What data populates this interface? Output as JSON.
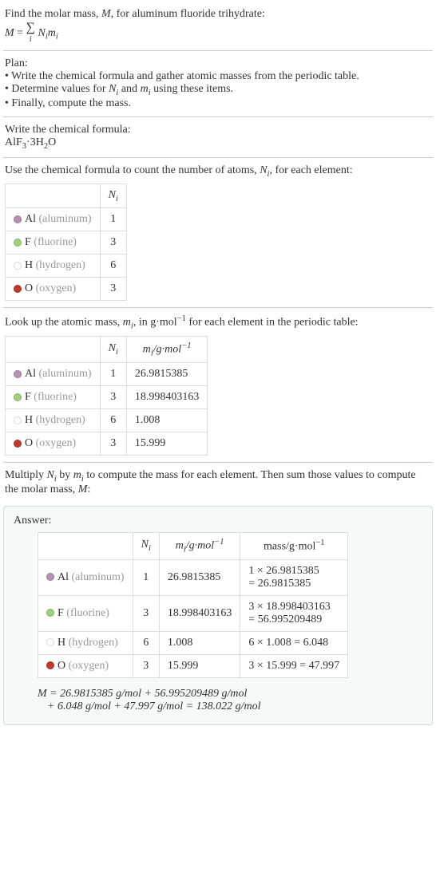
{
  "intro": {
    "line1_a": "Find the molar mass, ",
    "line1_b": ", for aluminum fluoride trihydrate:",
    "M": "M",
    "eq_lhs": "M",
    "eq_sum": "∑",
    "eq_idx": "i",
    "eq_rhs_a": "N",
    "eq_rhs_b": "m"
  },
  "plan": {
    "title": "Plan:",
    "b1": "• Write the chemical formula and gather atomic masses from the periodic table.",
    "b2_a": "• Determine values for ",
    "b2_b": " and ",
    "b2_c": " using these items.",
    "b3": "• Finally, compute the mass."
  },
  "step1": {
    "title": "Write the chemical formula:",
    "formula_parts": [
      "AlF",
      "3",
      "·3H",
      "2",
      "O"
    ]
  },
  "step2": {
    "title_a": "Use the chemical formula to count the number of atoms, ",
    "title_b": ", for each element:",
    "headers": [
      "N",
      "i"
    ],
    "rows": [
      {
        "dot": "#b98fb3",
        "sym": "Al",
        "name": "(aluminum)",
        "n": "1"
      },
      {
        "dot": "#9fd07a",
        "sym": "F",
        "name": "(fluorine)",
        "n": "3"
      },
      {
        "dot": "#ffffff",
        "sym": "H",
        "name": "(hydrogen)",
        "n": "6"
      },
      {
        "dot": "#c0392b",
        "sym": "O",
        "name": "(oxygen)",
        "n": "3"
      }
    ]
  },
  "step3": {
    "title_a": "Look up the atomic mass, ",
    "title_b": ", in g·mol",
    "title_c": " for each element in the periodic table:",
    "neg1": "−1",
    "h2_a": "m",
    "h2_b": "i",
    "h2_c": "/g·mol",
    "rows": [
      {
        "dot": "#b98fb3",
        "sym": "Al",
        "name": "(aluminum)",
        "n": "1",
        "m": "26.9815385"
      },
      {
        "dot": "#9fd07a",
        "sym": "F",
        "name": "(fluorine)",
        "n": "3",
        "m": "18.998403163"
      },
      {
        "dot": "#ffffff",
        "sym": "H",
        "name": "(hydrogen)",
        "n": "6",
        "m": "1.008"
      },
      {
        "dot": "#c0392b",
        "sym": "O",
        "name": "(oxygen)",
        "n": "3",
        "m": "15.999"
      }
    ]
  },
  "step4": {
    "text_a": "Multiply ",
    "text_b": " by ",
    "text_c": " to compute the mass for each element. Then sum those values to compute the molar mass, ",
    "text_d": ":"
  },
  "answer": {
    "label": "Answer:",
    "mass_hdr": "mass/g·mol",
    "rows": [
      {
        "dot": "#b98fb3",
        "sym": "Al",
        "name": "(aluminum)",
        "n": "1",
        "m": "26.9815385",
        "calc1": "1 × 26.9815385",
        "calc2": "= 26.9815385"
      },
      {
        "dot": "#9fd07a",
        "sym": "F",
        "name": "(fluorine)",
        "n": "3",
        "m": "18.998403163",
        "calc1": "3 × 18.998403163",
        "calc2": "= 56.995209489"
      },
      {
        "dot": "#ffffff",
        "sym": "H",
        "name": "(hydrogen)",
        "n": "6",
        "m": "1.008",
        "calc1": "6 × 1.008 = 6.048",
        "calc2": ""
      },
      {
        "dot": "#c0392b",
        "sym": "O",
        "name": "(oxygen)",
        "n": "3",
        "m": "15.999",
        "calc1": "3 × 15.999 = 47.997",
        "calc2": ""
      }
    ],
    "final1": "M = 26.9815385 g/mol + 56.995209489 g/mol",
    "final2": "+ 6.048 g/mol + 47.997 g/mol = 138.022 g/mol"
  }
}
